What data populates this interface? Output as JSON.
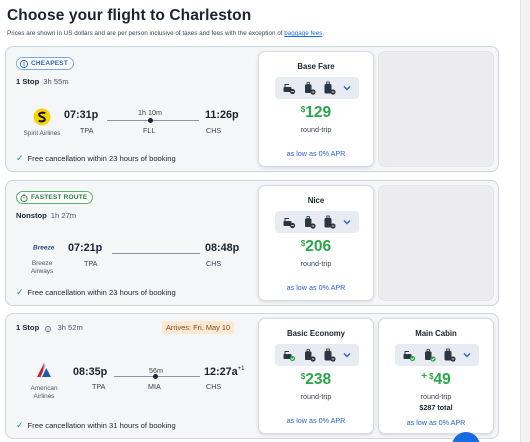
{
  "page": {
    "title": "Choose your flight to Charleston",
    "disclaimer": "Prices are shown in US dollars and are per person inclusive of taxes and fees with the exception of",
    "baggage_link": "baggage fees",
    "disclaimer_end": "."
  },
  "colors": {
    "price_green": "#2aa64a",
    "link_blue": "#2a63c8",
    "badge_blue": "#2a5fb0",
    "badge_green": "#2a7a3d"
  },
  "flights": [
    {
      "badge": "CHEAPEST",
      "badge_icon": "info-icon",
      "stops": "1 Stop",
      "duration": "3h 55m",
      "airline": "Spirit Airlines",
      "depart_time": "07:31p",
      "depart_code": "TPA",
      "segment_duration": "1h 10m",
      "via_code": "FLL",
      "arrive_time": "11:26p",
      "arrive_code": "CHS",
      "cancellation": "Free cancellation within 23 hours of booking",
      "fares": [
        {
          "title": "Base Fare",
          "price": "129",
          "currency": "$",
          "label": "round-trip",
          "apr": "as low as 0% APR"
        }
      ]
    },
    {
      "badge": "FASTEST ROUTE",
      "badge_icon": "stopwatch-icon",
      "stops": "Nonstop",
      "duration": "1h 27m",
      "airline": "Breeze Airways",
      "depart_time": "07:21p",
      "depart_code": "TPA",
      "arrive_time": "08:48p",
      "arrive_code": "CHS",
      "cancellation": "Free cancellation within 23 hours of booking",
      "fares": [
        {
          "title": "Nice",
          "price": "206",
          "currency": "$",
          "label": "round-trip",
          "apr": "as low as 0% APR"
        }
      ]
    },
    {
      "stops": "1 Stop",
      "duration": "3h 52m",
      "arrives_note": "Arrives: Fri, May 10",
      "airline": "American Airlines",
      "depart_time": "08:35p",
      "depart_code": "TPA",
      "segment_duration": "56m",
      "via_code": "MIA",
      "arrive_time": "12:27a",
      "arrive_day_offset": "+1",
      "arrive_code": "CHS",
      "cancellation": "Free cancellation within 31 hours of booking",
      "fares": [
        {
          "title": "Basic Economy",
          "price": "238",
          "currency": "$",
          "label": "round-trip",
          "apr": "as low as 0% APR"
        },
        {
          "title": "Main Cabin",
          "plus": "+",
          "price": "49",
          "currency": "$",
          "label": "round-trip",
          "total": "$287 total",
          "apr": "as low as 0% APR"
        }
      ]
    }
  ]
}
